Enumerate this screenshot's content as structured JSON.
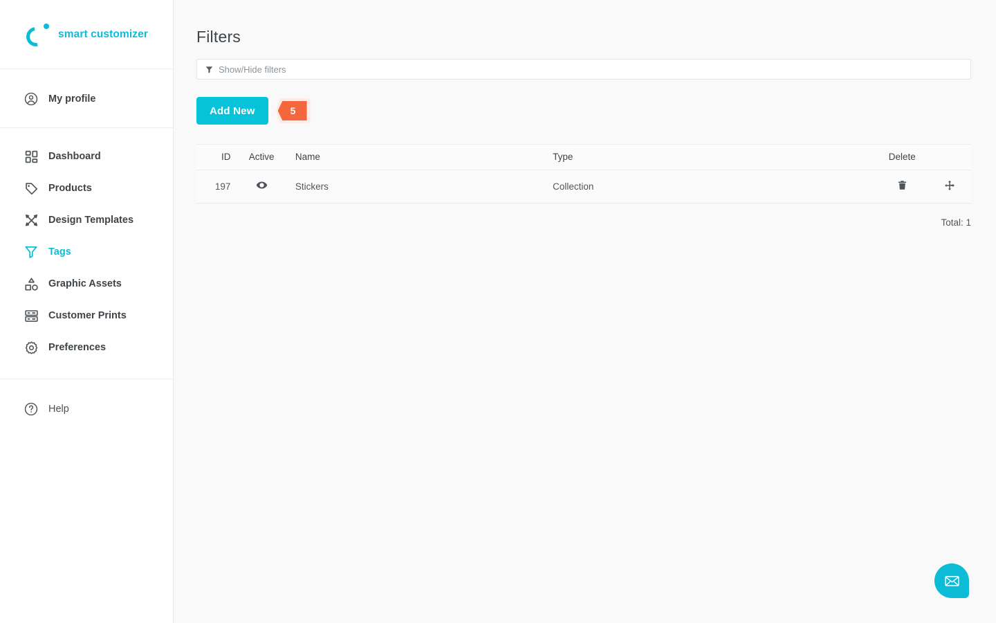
{
  "brand": {
    "name": "smart customizer",
    "logo_icon": "smart-customizer-logo-icon",
    "accent_color": "#0cbcd6"
  },
  "sidebar": {
    "groups": [
      {
        "id": "profile",
        "items": [
          {
            "label": "My profile",
            "icon": "user-circle-icon",
            "active": false
          }
        ]
      },
      {
        "id": "main",
        "items": [
          {
            "label": "Dashboard",
            "icon": "grid-icon",
            "active": false
          },
          {
            "label": "Products",
            "icon": "tag-icon",
            "active": false
          },
          {
            "label": "Design Templates",
            "icon": "pencils-icon",
            "active": false
          },
          {
            "label": "Tags",
            "icon": "funnel-icon",
            "active": true
          },
          {
            "label": "Graphic Assets",
            "icon": "shapes-icon",
            "active": false
          },
          {
            "label": "Customer Prints",
            "icon": "layers-icon",
            "active": false
          },
          {
            "label": "Preferences",
            "icon": "gear-icon",
            "active": false
          }
        ]
      },
      {
        "id": "help",
        "items": [
          {
            "label": "Help",
            "icon": "question-circle-icon",
            "active": false
          }
        ]
      }
    ]
  },
  "main": {
    "page_title": "Filters",
    "filter_toggle": {
      "label": "Show/Hide filters",
      "icon": "funnel-icon"
    },
    "toolbar": {
      "add_new_label": "Add New",
      "badge_count": "5",
      "badge_color": "#f4673c",
      "button_color": "#06c3da"
    },
    "table": {
      "columns": {
        "id": "ID",
        "active": "Active",
        "name": "Name",
        "type": "Type",
        "delete": "Delete",
        "move": ""
      },
      "rows": [
        {
          "id": "197",
          "active_icon": "eye-icon",
          "name": "Stickers",
          "type": "Collection",
          "delete_icon": "trash-icon",
          "move_icon": "move-arrows-icon"
        }
      ],
      "total_label": "Total: 1"
    },
    "chat": {
      "icon": "envelope-icon",
      "color": "#0cbcd6"
    }
  }
}
